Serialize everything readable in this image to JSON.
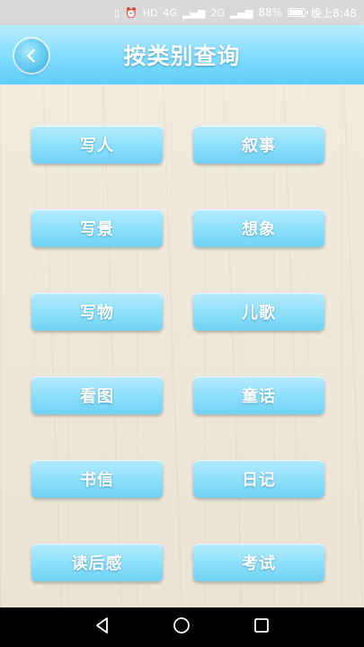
{
  "status_bar": {
    "left_icons": "vibrate-icon alarm-icon hd-icon signal-icon",
    "network_4g": "4G",
    "network_2g": "2G",
    "battery_percent": "88%",
    "time": "晚上8:48"
  },
  "header": {
    "title": "按类别查询"
  },
  "categories": [
    "写人",
    "叙事",
    "写景",
    "想象",
    "写物",
    "儿歌",
    "看图",
    "童话",
    "书信",
    "日记",
    "读后感",
    "考试"
  ],
  "colors": {
    "accent": "#7fdcff",
    "button": "#8fe0fb",
    "background": "#efe8dc"
  }
}
